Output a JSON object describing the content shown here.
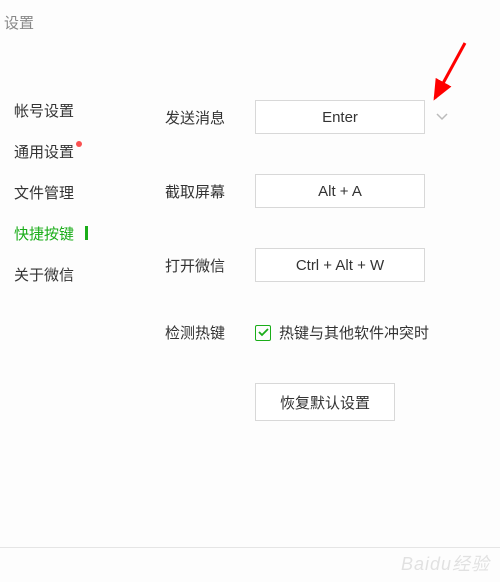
{
  "title": "设置",
  "sidebar": {
    "items": [
      {
        "label": "帐号设置",
        "active": false,
        "dot": false
      },
      {
        "label": "通用设置",
        "active": false,
        "dot": true
      },
      {
        "label": "文件管理",
        "active": false,
        "dot": false
      },
      {
        "label": "快捷按键",
        "active": true,
        "dot": false
      },
      {
        "label": "关于微信",
        "active": false,
        "dot": false
      }
    ]
  },
  "rows": {
    "send": {
      "label": "发送消息",
      "value": "Enter"
    },
    "capture": {
      "label": "截取屏幕",
      "value": "Alt + A"
    },
    "open": {
      "label": "打开微信",
      "value": "Ctrl + Alt + W"
    },
    "detect": {
      "label": "检测热键",
      "checkLabel": "热键与其他软件冲突时"
    }
  },
  "restore": "恢复默认设置",
  "watermark": "Baidu经验"
}
